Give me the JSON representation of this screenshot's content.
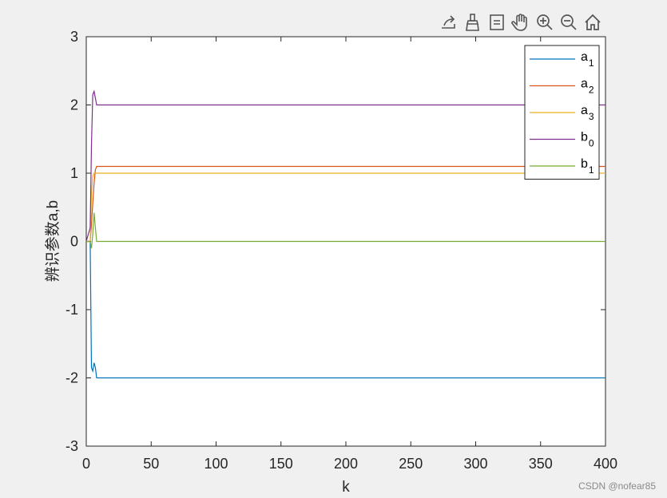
{
  "toolbar": {
    "buttons": [
      {
        "name": "export-icon"
      },
      {
        "name": "brush-icon"
      },
      {
        "name": "data-tips-icon"
      },
      {
        "name": "pan-hand-icon"
      },
      {
        "name": "zoom-in-icon"
      },
      {
        "name": "zoom-out-icon"
      },
      {
        "name": "home-icon"
      }
    ]
  },
  "watermark": "CSDN @nofear85",
  "chart_data": {
    "type": "line",
    "title": "",
    "xlabel": "k",
    "ylabel": "辨识参数a,b",
    "xlim": [
      0,
      400
    ],
    "ylim": [
      -3,
      3
    ],
    "xticks": [
      0,
      50,
      100,
      150,
      200,
      250,
      300,
      350,
      400
    ],
    "yticks": [
      -3,
      -2,
      -1,
      0,
      1,
      2,
      3
    ],
    "grid": false,
    "legend_position": "top-right",
    "series": [
      {
        "name": "a",
        "subscript": "1",
        "color": "#0072BD",
        "x": [
          0,
          3,
          4,
          5,
          6,
          7,
          8,
          10,
          400
        ],
        "y": [
          0,
          0,
          -1.85,
          -1.9,
          -1.78,
          -1.85,
          -2.0,
          -2.0,
          -2.0
        ]
      },
      {
        "name": "a",
        "subscript": "2",
        "color": "#D95319",
        "x": [
          0,
          3,
          4,
          5,
          6,
          7,
          8,
          10,
          400
        ],
        "y": [
          0,
          0,
          0.25,
          0.55,
          0.85,
          1.05,
          1.1,
          1.1,
          1.1
        ]
      },
      {
        "name": "a",
        "subscript": "3",
        "color": "#EDB120",
        "x": [
          0,
          3,
          4,
          5,
          6,
          8,
          400
        ],
        "y": [
          0,
          0,
          0.7,
          0.95,
          1.0,
          1.0,
          1.0
        ]
      },
      {
        "name": "b",
        "subscript": "0",
        "color": "#7E2F8E",
        "x": [
          0,
          3,
          4,
          5,
          6,
          7,
          8,
          10,
          400
        ],
        "y": [
          0,
          0.2,
          1.4,
          2.15,
          2.2,
          2.1,
          2.0,
          2.0,
          2.0
        ]
      },
      {
        "name": "b",
        "subscript": "1",
        "color": "#77AC30",
        "x": [
          0,
          3,
          4,
          5,
          6,
          7,
          8,
          10,
          400
        ],
        "y": [
          0,
          0,
          -0.1,
          0.1,
          0.42,
          0.2,
          0.0,
          0.0,
          0.0
        ]
      }
    ]
  }
}
